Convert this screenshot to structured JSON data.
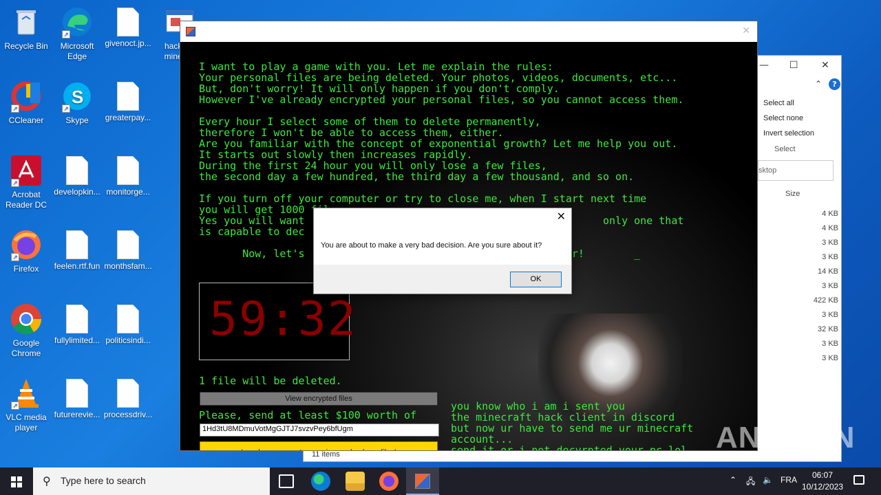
{
  "desktop": {
    "icons": [
      {
        "label": "Recycle Bin"
      },
      {
        "label": "Microsoft Edge"
      },
      {
        "label": "givenoct.jp..."
      },
      {
        "label": "hack t... mined..."
      },
      {
        "label": "CCleaner"
      },
      {
        "label": "Skype"
      },
      {
        "label": "greaterpay..."
      },
      {
        "label": "Acrobat Reader DC"
      },
      {
        "label": "developkin..."
      },
      {
        "label": "monitorge..."
      },
      {
        "label": "Firefox"
      },
      {
        "label": "feelen.rtf.fun"
      },
      {
        "label": "monthsfam..."
      },
      {
        "label": "Google Chrome"
      },
      {
        "label": "fullylimited..."
      },
      {
        "label": "politicsindi..."
      },
      {
        "label": "VLC media player"
      },
      {
        "label": "futurerevie..."
      },
      {
        "label": "processdriv..."
      }
    ]
  },
  "explorer": {
    "select_all": "Select all",
    "select_none": "Select none",
    "invert_selection": "Invert selection",
    "select_group": "Select",
    "search_path": "sktop",
    "size_header": "Size",
    "sizes": [
      "4 KB",
      "4 KB",
      "3 KB",
      "3 KB",
      "14 KB",
      "3 KB",
      "422 KB",
      "3 KB",
      "32 KB",
      "3 KB",
      "3 KB"
    ],
    "item_count": "11 items"
  },
  "ransom": {
    "message": "I want to play a game with you. Let me explain the rules:\nYour personal files are being deleted. Your photos, videos, documents, etc...\nBut, don't worry! It will only happen if you don't comply.\nHowever I've already encrypted your personal files, so you cannot access them.\n\nEvery hour I select some of them to delete permanently,\ntherefore I won't be able to access them, either.\nAre you familiar with the concept of exponential growth? Let me help you out.\nIt starts out slowly then increases rapidly.\nDuring the first 24 hour you will only lose a few files,\nthe second day a few hundred, the third day a few thousand, and so on.\n\nIf you turn off your computer or try to close me, when I start next time\nyou will get 1000 fil\nYes you will want                                                only one that\nis capable to dec\n\n       Now, let's                                         her!        _",
    "timer": "59:32",
    "files_deleted": "1 file will be deleted.",
    "view_button": "View encrypted files",
    "send_text": "Please, send at least $100 worth of",
    "wallet": "1Hd3tU8MDmuVotMgGJTJ7svzvPey6bfUgm",
    "paid_button": "I made a payment, now give me back my files!",
    "discord_message": "you know who i am i sent you\nthe minecraft hack client in discord\nbut now ur have to send me ur minecraft\naccount...\nsend it or i not decyrpted your pc lol"
  },
  "dialog": {
    "message": "You are about to make a very bad decision. Are you sure about it?",
    "ok": "OK"
  },
  "taskbar": {
    "search_placeholder": "Type here to search",
    "language": "FRA",
    "time": "06:07",
    "date": "10/12/2023"
  },
  "watermark": "ANY.RUN"
}
